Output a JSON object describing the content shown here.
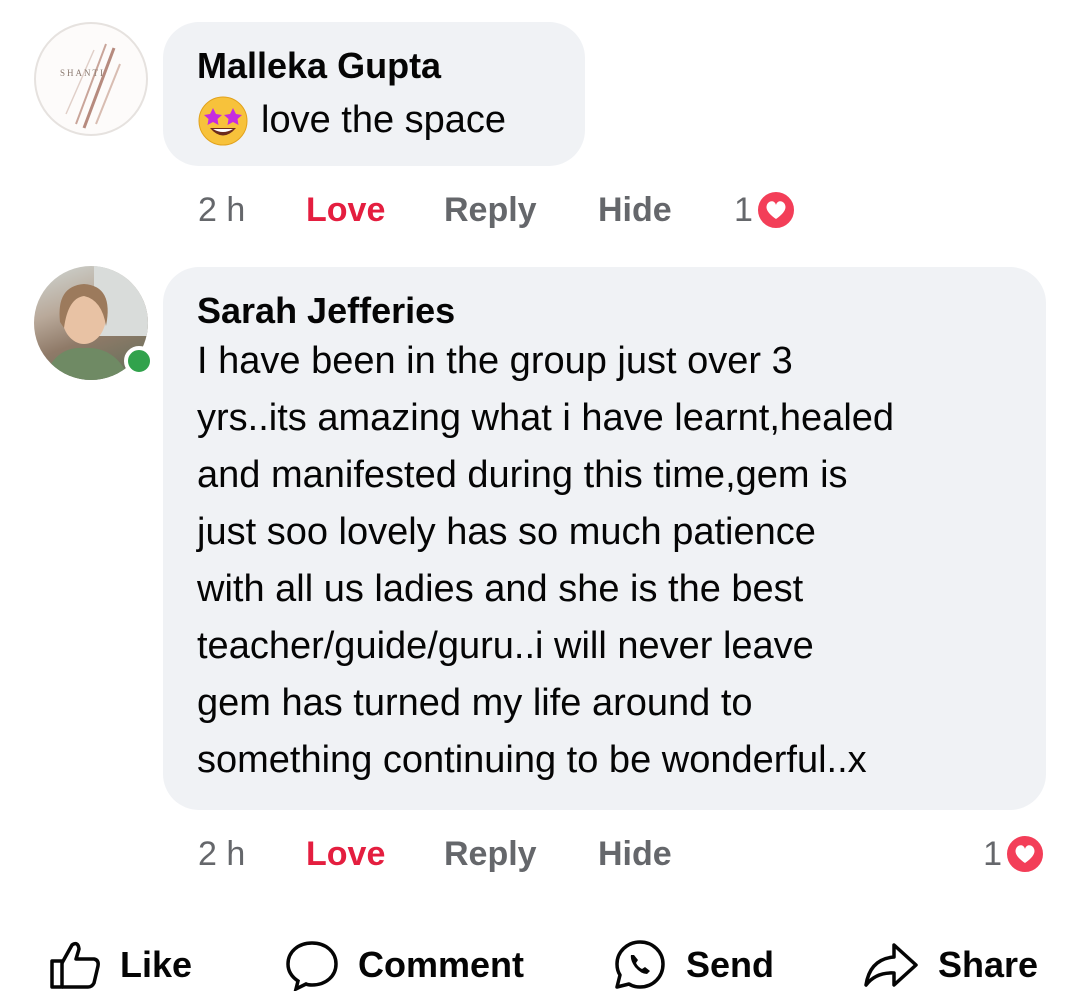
{
  "comments": [
    {
      "author": "Malleka Gupta",
      "avatar_text": "SHANTI",
      "text": "love the space",
      "emoji": "star-struck",
      "time": "2 h",
      "love_label": "Love",
      "reply_label": "Reply",
      "hide_label": "Hide",
      "reaction_count": "1",
      "reaction_type": "heart-icon"
    },
    {
      "author": "Sarah Jefferies",
      "online": true,
      "text": "I have been in the group just over 3\nyrs..its amazing what i have learnt,healed\nand manifested during this time,gem is\njust soo lovely has so much patience\nwith all us ladies and she is the best\nteacher/guide/guru..i will never leave\ngem has turned my life around to\nsomething continuing to be wonderful..x",
      "time": "2 h",
      "love_label": "Love",
      "reply_label": "Reply",
      "hide_label": "Hide",
      "reaction_count": "1",
      "reaction_type": "heart-icon"
    }
  ],
  "actions": {
    "like": "Like",
    "comment": "Comment",
    "send": "Send",
    "share": "Share"
  },
  "colors": {
    "bubble": "#f0f2f5",
    "love": "#e41e3f",
    "meta": "#65676b",
    "online": "#31a24c",
    "heart": "#f33e58"
  }
}
